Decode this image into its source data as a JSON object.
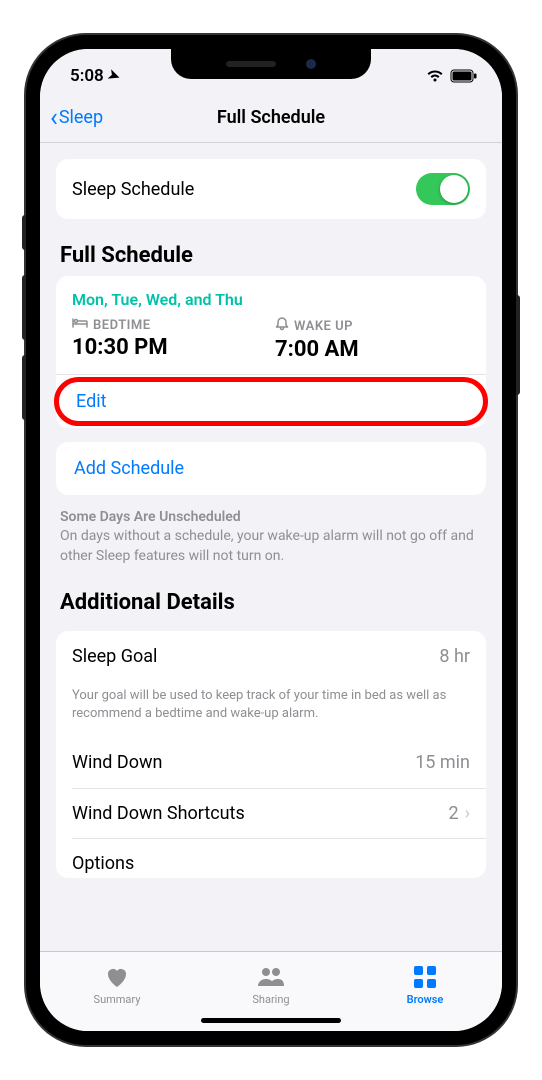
{
  "status": {
    "time": "5:08",
    "location_icon": "location-arrow"
  },
  "nav": {
    "back_label": "Sleep",
    "title": "Full Schedule"
  },
  "sleep_schedule": {
    "label": "Sleep Schedule",
    "enabled": true
  },
  "full_schedule": {
    "header": "Full Schedule",
    "days": "Mon, Tue, Wed, and Thu",
    "bedtime_label": "BEDTIME",
    "bedtime_value": "10:30 PM",
    "wakeup_label": "WAKE UP",
    "wakeup_value": "7:00 AM",
    "edit_label": "Edit"
  },
  "add_schedule_label": "Add Schedule",
  "unscheduled": {
    "title": "Some Days Are Unscheduled",
    "body": "On days without a schedule, your wake-up alarm will not go off and other Sleep features will not turn on."
  },
  "additional": {
    "header": "Additional Details",
    "sleep_goal_label": "Sleep Goal",
    "sleep_goal_value": "8 hr",
    "goal_footnote": "Your goal will be used to keep track of your time in bed as well as recommend a bedtime and wake-up alarm.",
    "wind_down_label": "Wind Down",
    "wind_down_value": "15 min",
    "shortcuts_label": "Wind Down Shortcuts",
    "shortcuts_value": "2",
    "options_label": "Options"
  },
  "tabs": {
    "summary": "Summary",
    "sharing": "Sharing",
    "browse": "Browse"
  }
}
